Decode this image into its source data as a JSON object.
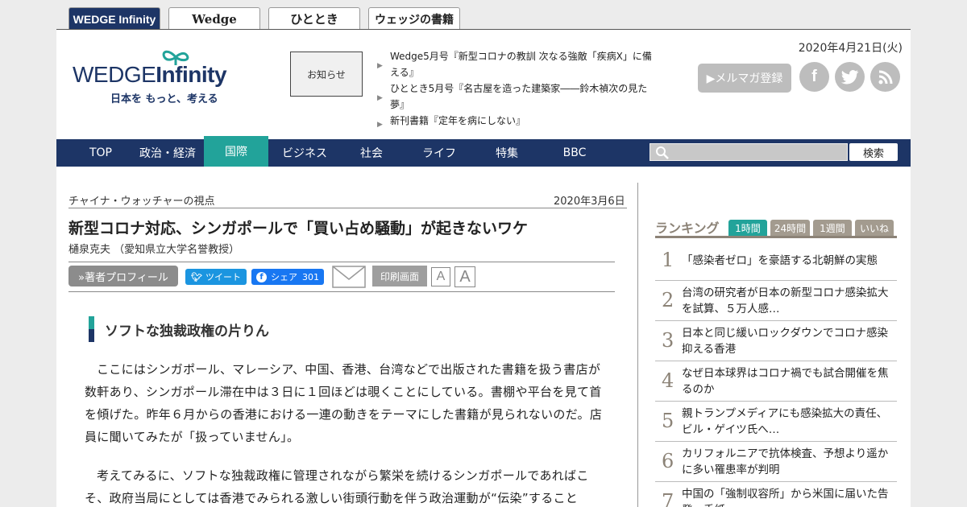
{
  "site_tabs": [
    "WEDGE Infinity",
    "Wedge",
    "ひととき",
    "ウェッジの書籍"
  ],
  "logo": {
    "name_wedge": "WEDGE",
    "name_infinity": "Infinity",
    "tagline": "日本を もっと、考える"
  },
  "notice_label": "お知らせ",
  "news": [
    "Wedge5月号『新型コロナの教訓 次なる強敵「疾病X」に備える』",
    "ひととき5月号『名古屋を造った建築家――鈴木禎次の見た夢』",
    "新刊書籍『定年を病にしない』"
  ],
  "date": "2020年4月21日(火)",
  "mailmag_label": "▶メルマガ登録",
  "social_icons": [
    "facebook-icon",
    "twitter-icon",
    "rss-icon"
  ],
  "nav": [
    "TOP",
    "政治・経済",
    "国際",
    "ビジネス",
    "社会",
    "ライフ",
    "特集",
    "BBC"
  ],
  "nav_active": "国際",
  "search_button": "検索",
  "article": {
    "series": "チャイナ・ウォッチャーの視点",
    "date": "2020年3月6日",
    "title": "新型コロナ対応、シンガポールで「買い占め騒動」が起きないワケ",
    "author": "樋泉克夫 （愛知県立大学名誉教授）",
    "profile_button": "»著者プロフィール",
    "tweet_label": "ツイート",
    "share_label": "シェア",
    "share_count": "301",
    "print_label": "印刷画面",
    "font_small": "A",
    "font_large": "A",
    "section_heading": "ソフトな独裁政権の片りん",
    "paragraphs": [
      "ここにはシンガポール、マレーシア、中国、香港、台湾などで出版された書籍を扱う書店が数軒あり、シンガポール滞在中は３日に１回ほどは覗くことにしている。書棚や平台を見て首を傾げた。昨年６月からの香港における一連の動きをテーマにした書籍が見られないのだ。店員に聞いてみたが「扱っていません」。",
      "考えてみるに、ソフトな独裁政権に管理されながら繁栄を続けるシンガポールであればこそ、政府当局にとしては香港でみられる激しい街頭行動を伴う政治運動が“伝染”すること"
    ]
  },
  "ranking": {
    "title": "ランキング",
    "tabs": [
      "1時間",
      "24時間",
      "1週間",
      "いいね"
    ],
    "active_tab": "1時間",
    "items": [
      {
        "rank": "1",
        "text": "「感染者ゼロ」を豪語する北朝鮮の実態"
      },
      {
        "rank": "2",
        "text": "台湾の研究者が日本の新型コロナ感染拡大を試算、５万人感…"
      },
      {
        "rank": "3",
        "text": "日本と同じ緩いロックダウンでコロナ感染抑える香港"
      },
      {
        "rank": "4",
        "text": "なぜ日本球界はコロナ禍でも試合開催を焦るのか"
      },
      {
        "rank": "5",
        "text": "親トランプメディアにも感染拡大の責任、ビル・ゲイツ氏へ…"
      },
      {
        "rank": "6",
        "text": "カリフォルニアで抗体検査、予想より遥かに多い罹患率が判明"
      },
      {
        "rank": "7",
        "text": "中国の「強制収容所」から米国に届いた告発　手紙…"
      }
    ]
  },
  "colors": {
    "navy": "#1d3566",
    "teal": "#22a39a",
    "ranking_brown": "#8c8377"
  }
}
